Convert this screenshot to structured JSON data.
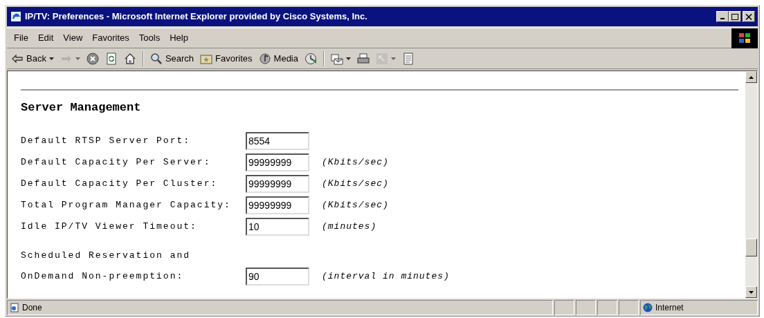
{
  "window": {
    "title": "IP/TV: Preferences - Microsoft Internet Explorer provided by Cisco Systems, Inc."
  },
  "menu": [
    "File",
    "Edit",
    "View",
    "Favorites",
    "Tools",
    "Help"
  ],
  "toolbar": [
    {
      "kind": "back",
      "label": "Back",
      "has_menu": true,
      "disabled": false
    },
    {
      "kind": "forward",
      "has_menu": true,
      "disabled": true
    },
    {
      "kind": "stop",
      "has_menu": false,
      "disabled": false
    },
    {
      "kind": "refresh",
      "has_menu": false,
      "disabled": false
    },
    {
      "kind": "home",
      "has_menu": false,
      "disabled": false
    },
    {
      "kind": "separator"
    },
    {
      "kind": "search",
      "label": "Search",
      "has_menu": false,
      "disabled": false
    },
    {
      "kind": "favorites",
      "label": "Favorites",
      "has_menu": false,
      "disabled": false
    },
    {
      "kind": "media",
      "label": "Media",
      "has_menu": false,
      "disabled": false
    },
    {
      "kind": "history",
      "has_menu": false,
      "disabled": false
    },
    {
      "kind": "separator"
    },
    {
      "kind": "mail",
      "has_menu": true,
      "disabled": false
    },
    {
      "kind": "print",
      "has_menu": false,
      "disabled": false
    },
    {
      "kind": "edit",
      "has_menu": true,
      "disabled": true
    },
    {
      "kind": "discuss",
      "has_menu": false,
      "disabled": false
    }
  ],
  "content": {
    "heading": "Server Management",
    "fields": [
      {
        "label": "Default RTSP Server Port:",
        "value": "8554"
      },
      {
        "label": "Default Capacity Per Server:",
        "value": "99999999",
        "unit": "(Kbits/sec)"
      },
      {
        "label": "Default Capacity Per Cluster:",
        "value": "99999999",
        "unit": "(Kbits/sec)"
      },
      {
        "label": "Total Program Manager Capacity:",
        "value": "99999999",
        "unit": "(Kbits/sec)"
      },
      {
        "label": "Idle IP/TV Viewer Timeout:",
        "value": "10",
        "unit": "(minutes)"
      },
      {
        "label_above": "Scheduled Reservation and",
        "label": "OnDemand Non-preemption:",
        "value": "90",
        "unit": "(interval in minutes)"
      }
    ]
  },
  "status_bar": {
    "text": "Done",
    "zone": "Internet"
  }
}
